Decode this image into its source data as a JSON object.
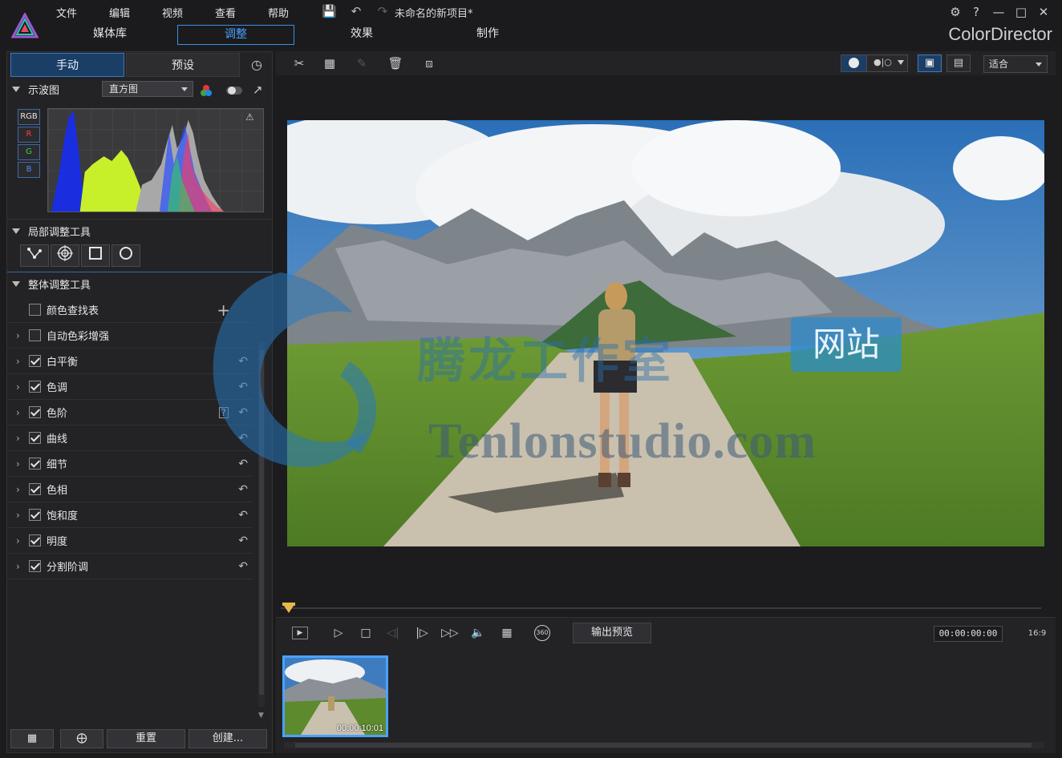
{
  "app": {
    "brand": "ColorDirector",
    "project_title": "未命名的新项目*",
    "menu": [
      "文件",
      "编辑",
      "视频",
      "查看",
      "帮助"
    ],
    "mode_tabs": [
      "媒体库",
      "调整",
      "效果",
      "制作"
    ],
    "active_mode": "调整"
  },
  "left_panel": {
    "tabs": [
      "手动",
      "预设"
    ],
    "active_tab": "手动",
    "waveform": {
      "label": "示波图",
      "select_value": "直方图",
      "channels": [
        "RGB",
        "R",
        "G",
        "B"
      ]
    },
    "local_tools": {
      "label": "局部调整工具",
      "tools": [
        "path-icon",
        "radial-target-icon",
        "square-mask-icon",
        "circle-mask-icon"
      ]
    },
    "global_tools": {
      "label": "整体调整工具",
      "items": [
        {
          "label": "颜色查找表",
          "checked": false
        },
        {
          "label": "自动色彩增强",
          "checked": false
        },
        {
          "label": "白平衡",
          "checked": true
        },
        {
          "label": "色调",
          "checked": true
        },
        {
          "label": "色阶",
          "checked": true
        },
        {
          "label": "曲线",
          "checked": true
        },
        {
          "label": "细节",
          "checked": true
        },
        {
          "label": "色相",
          "checked": true
        },
        {
          "label": "饱和度",
          "checked": true
        },
        {
          "label": "明度",
          "checked": true
        },
        {
          "label": "分割阶调",
          "checked": true
        }
      ]
    },
    "bottom_buttons": {
      "reset": "重置",
      "create": "创建..."
    }
  },
  "viewer": {
    "fit_select": "适合",
    "output_preview": "输出预览",
    "timecode": "00:00:00:00",
    "aspect": "16:9",
    "thumb_time": "00:00:10:01",
    "badge_360": "360"
  },
  "watermark": {
    "site": "网站",
    "domain": "Tenlonstudio.com",
    "cn": "腾龙工作室"
  },
  "colors": {
    "accent": "#4aa2ff",
    "panel": "#232326",
    "background": "#1c1c1e"
  }
}
